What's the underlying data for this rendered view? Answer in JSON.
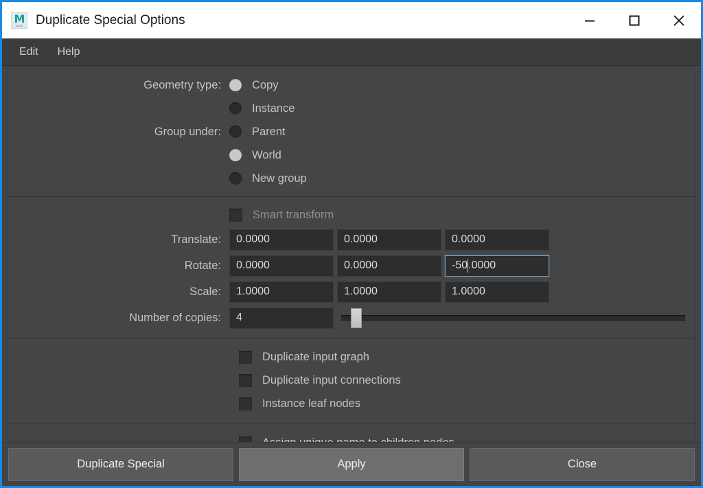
{
  "window": {
    "title": "Duplicate Special Options",
    "icon": "maya-app-icon",
    "icon_letter": "M",
    "icon_subtext": "MAYA",
    "accent_color": "#1a8ae5",
    "controls": [
      {
        "name": "minimize",
        "glyph": "minimize-icon"
      },
      {
        "name": "maximize",
        "glyph": "maximize-icon"
      },
      {
        "name": "close",
        "glyph": "close-icon"
      }
    ]
  },
  "menubar": {
    "items": [
      {
        "label": "Edit"
      },
      {
        "label": "Help"
      }
    ]
  },
  "form": {
    "geometry_type": {
      "label": "Geometry type:",
      "options": [
        {
          "label": "Copy",
          "selected": true
        },
        {
          "label": "Instance",
          "selected": false
        }
      ]
    },
    "group_under": {
      "label": "Group under:",
      "options": [
        {
          "label": "Parent",
          "selected": false
        },
        {
          "label": "World",
          "selected": true
        },
        {
          "label": "New group",
          "selected": false
        }
      ]
    },
    "smart_transform": {
      "label": "Smart transform",
      "checked": false,
      "disabled": true
    },
    "transform_rows": [
      {
        "label": "Translate:",
        "values": [
          "0.0000",
          "0.0000",
          "0.0000"
        ],
        "focused_index": -1
      },
      {
        "label": "Rotate:",
        "values": [
          "0.0000",
          "0.0000",
          "-50.0000"
        ],
        "focused_index": 2
      },
      {
        "label": "Scale:",
        "values": [
          "1.0000",
          "1.0000",
          "1.0000"
        ],
        "focused_index": -1
      }
    ],
    "rotate_z_caret": {
      "before": "-50",
      "after": ".0000"
    },
    "number_of_copies": {
      "label": "Number of copies:",
      "value": "4",
      "slider_percent": 4
    },
    "checkboxes": [
      {
        "label": "Duplicate input graph",
        "checked": false
      },
      {
        "label": "Duplicate input connections",
        "checked": false
      },
      {
        "label": "Instance leaf nodes",
        "checked": false
      }
    ],
    "checkboxes_last": [
      {
        "label": "Assign unique name to children nodes",
        "checked": false
      }
    ]
  },
  "buttons": [
    {
      "label": "Duplicate Special",
      "state": "normal"
    },
    {
      "label": "Apply",
      "state": "hover"
    },
    {
      "label": "Close",
      "state": "normal"
    }
  ]
}
